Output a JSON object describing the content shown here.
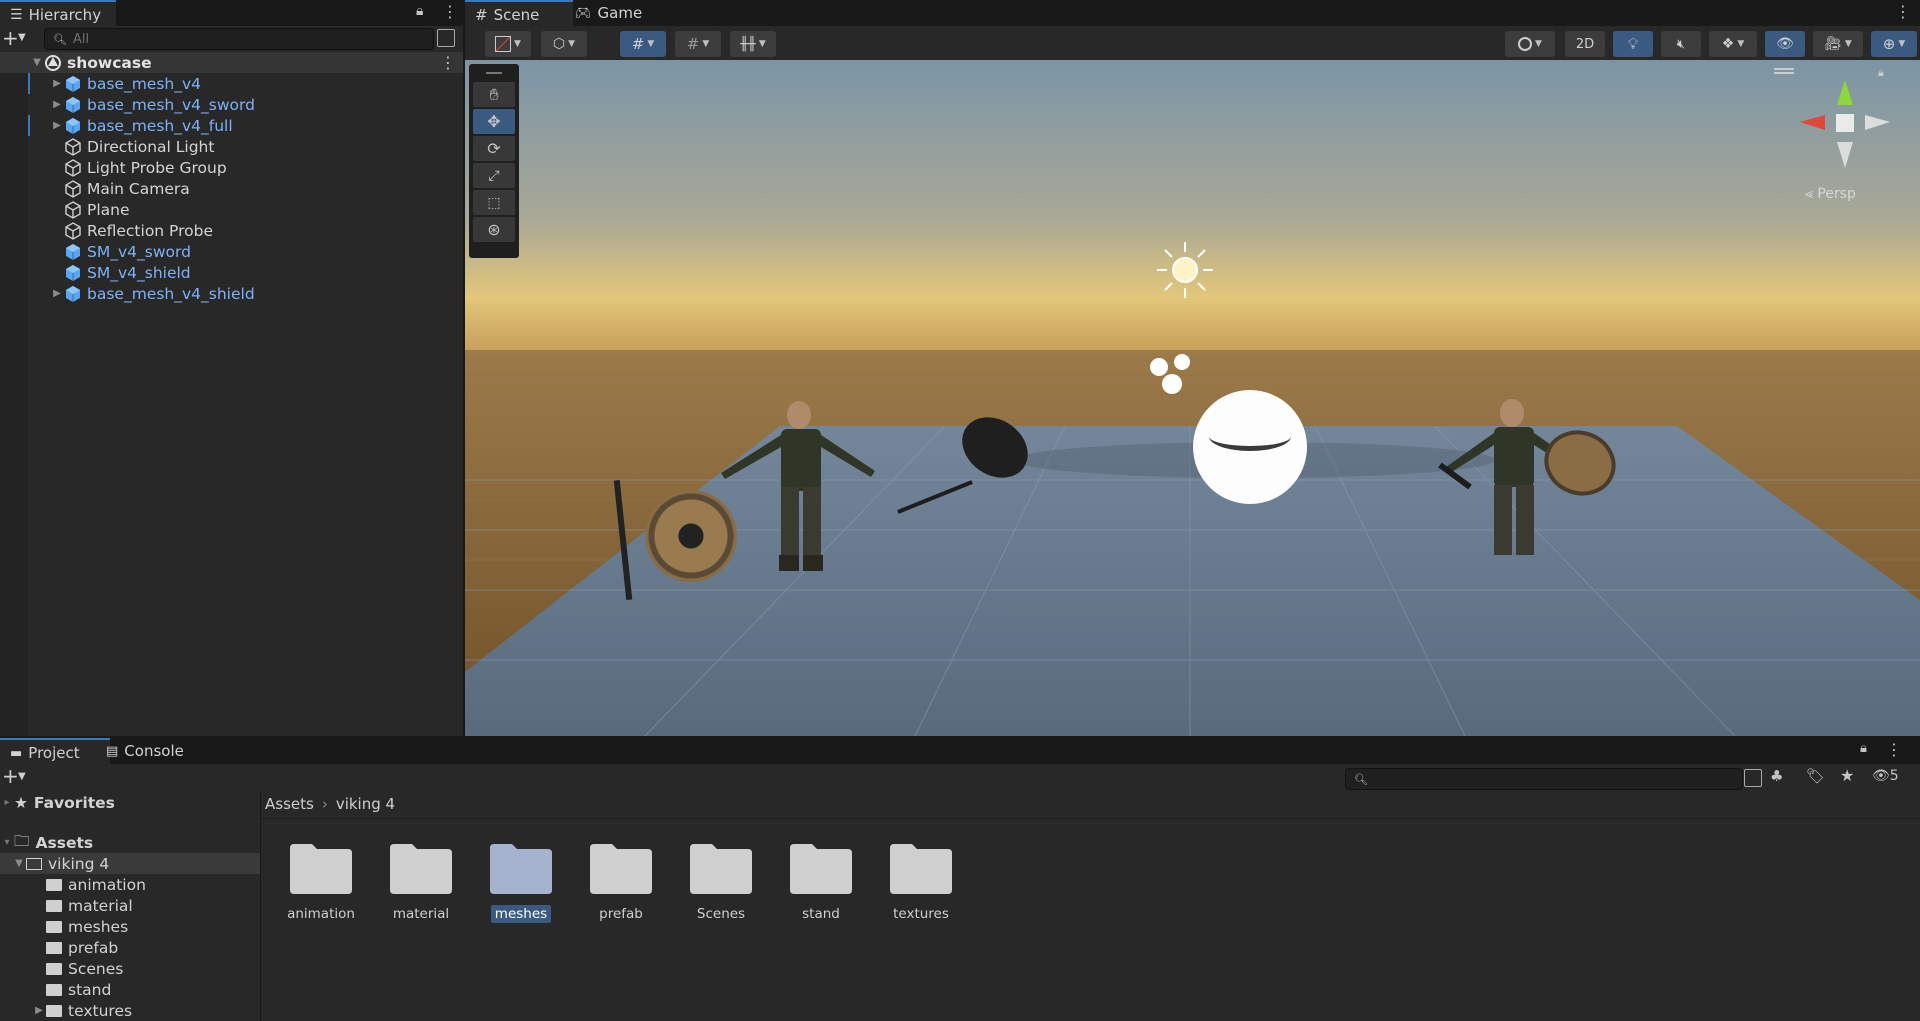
{
  "hierarchy": {
    "tab_label": "Hierarchy",
    "search_placeholder": "All",
    "scene_name": "showcase",
    "items": [
      {
        "label": "base_mesh_v4",
        "prefab": true,
        "expandable": true
      },
      {
        "label": "base_mesh_v4_sword",
        "prefab": true,
        "expandable": true
      },
      {
        "label": "base_mesh_v4_full",
        "prefab": true,
        "expandable": true
      },
      {
        "label": "Directional Light",
        "prefab": false,
        "expandable": false
      },
      {
        "label": "Light Probe Group",
        "prefab": false,
        "expandable": false
      },
      {
        "label": "Main Camera",
        "prefab": false,
        "expandable": false
      },
      {
        "label": "Plane",
        "prefab": false,
        "expandable": false
      },
      {
        "label": "Reflection Probe",
        "prefab": false,
        "expandable": false
      },
      {
        "label": "SM_v4_sword",
        "prefab": true,
        "expandable": false
      },
      {
        "label": "SM_v4_shield",
        "prefab": true,
        "expandable": false
      },
      {
        "label": "base_mesh_v4_shield",
        "prefab": true,
        "expandable": true
      }
    ]
  },
  "scene_view": {
    "tab_scene": "Scene",
    "tab_game": "Game",
    "toggle_2d": "2D",
    "projection_label": "Persp"
  },
  "project": {
    "tab_project": "Project",
    "tab_console": "Console",
    "hidden_count": "5",
    "favorites_label": "Favorites",
    "assets_label": "Assets",
    "breadcrumb": [
      "Assets",
      "viking 4"
    ],
    "tree": [
      {
        "label": "viking 4",
        "level": 1,
        "open": true
      },
      {
        "label": "animation",
        "level": 2
      },
      {
        "label": "material",
        "level": 2
      },
      {
        "label": "meshes",
        "level": 2
      },
      {
        "label": "prefab",
        "level": 2
      },
      {
        "label": "Scenes",
        "level": 2
      },
      {
        "label": "stand",
        "level": 2
      },
      {
        "label": "textures",
        "level": 2,
        "expandable": true
      }
    ],
    "folders": [
      {
        "label": "animation",
        "selected": false
      },
      {
        "label": "material",
        "selected": false
      },
      {
        "label": "meshes",
        "selected": true
      },
      {
        "label": "prefab",
        "selected": false
      },
      {
        "label": "Scenes",
        "selected": false
      },
      {
        "label": "stand",
        "selected": false
      },
      {
        "label": "textures",
        "selected": false
      }
    ]
  },
  "colors": {
    "accent": "#3a79bb",
    "prefab_text": "#7eb1f5",
    "selected_folder": "#3b5a82"
  }
}
